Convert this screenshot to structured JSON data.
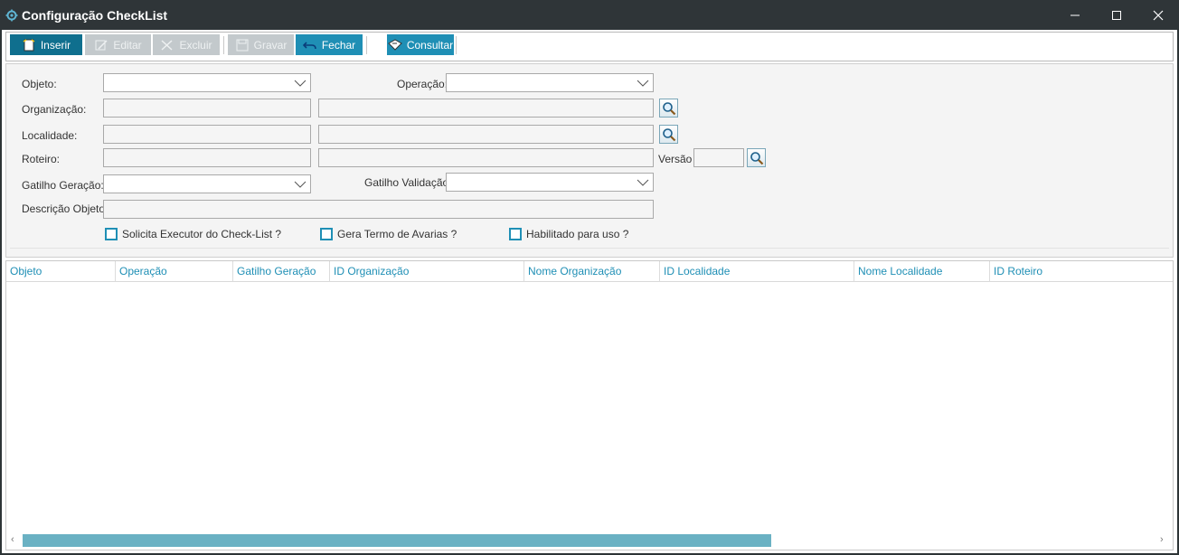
{
  "window": {
    "title": "Configuração CheckList",
    "icons": {
      "app": "gear-icon",
      "minimize": "minimize-icon",
      "maximize": "maximize-icon",
      "close": "close-icon"
    }
  },
  "toolbar": {
    "inserir": "Inserir",
    "editar": "Editar",
    "excluir": "Excluir",
    "gravar": "Gravar",
    "fechar": "Fechar",
    "consultar": "Consultar"
  },
  "form": {
    "objeto_label": "Objeto:",
    "objeto_value": "",
    "operacao_label": "Operação:",
    "operacao_value": "",
    "organizacao_label": "Organização:",
    "organizacao_id": "",
    "organizacao_nome": "",
    "localidade_label": "Localidade:",
    "localidade_id": "",
    "localidade_nome": "",
    "roteiro_label": "Roteiro:",
    "roteiro_id": "",
    "roteiro_nome": "",
    "versao_label": "Versão",
    "versao_value": "",
    "gatilho_geracao_label": "Gatilho Geração:",
    "gatilho_geracao_value": "",
    "gatilho_validacao_label": "Gatilho Validação:",
    "gatilho_validacao_value": "",
    "descricao_label": "Descrição Objeto:",
    "descricao_value": "",
    "checkboxes": {
      "solicita_executor": {
        "label": "Solicita Executor do Check-List ?",
        "checked": false
      },
      "gera_termo": {
        "label": "Gera Termo de Avarias ?",
        "checked": false
      },
      "habilitado": {
        "label": "Habilitado para uso ?",
        "checked": false
      }
    }
  },
  "grid": {
    "columns": [
      "Objeto",
      "Operação",
      "Gatilho Geração",
      "ID Organização",
      "Nome Organização",
      "ID Localidade",
      "Nome Localidade",
      "ID Roteiro"
    ],
    "rows": [],
    "scroll_left_arrow": "‹",
    "scroll_right_arrow": "›"
  },
  "colors": {
    "accent": "#1f8fb5",
    "titlebar": "#2f3538",
    "scroll_thumb": "#6ab1c3"
  }
}
